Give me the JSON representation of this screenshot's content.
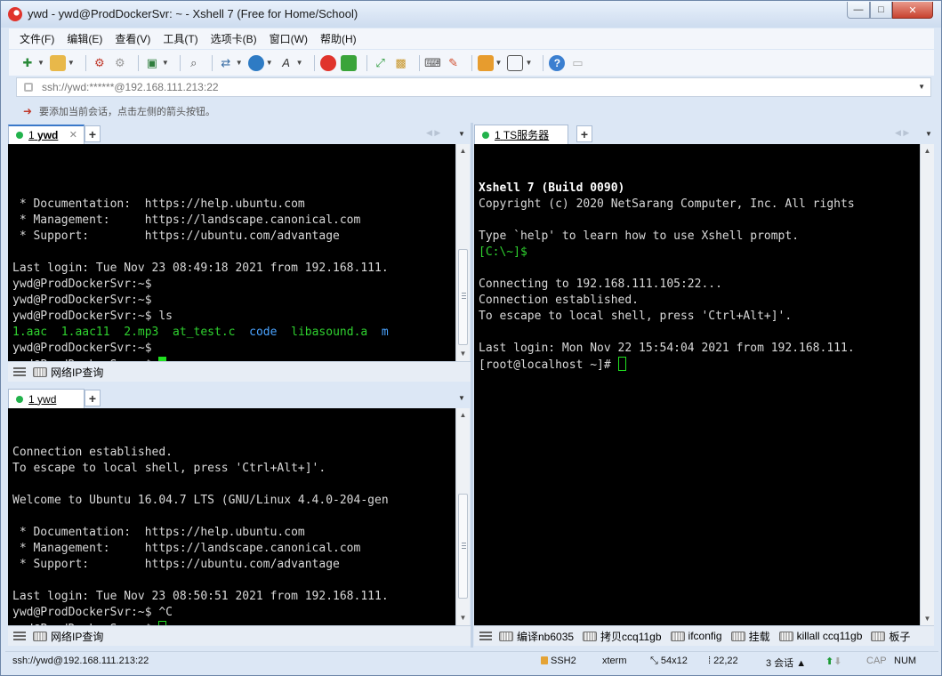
{
  "window": {
    "title": "ywd - ywd@ProdDockerSvr: ~ - Xshell 7 (Free for Home/School)",
    "controls": {
      "minimize": "—",
      "maximize": "□",
      "close": "✕"
    }
  },
  "menu": [
    "文件(F)",
    "编辑(E)",
    "查看(V)",
    "工具(T)",
    "选项卡(B)",
    "窗口(W)",
    "帮助(H)"
  ],
  "address": {
    "value": "ssh://ywd:******@192.168.111.213:22"
  },
  "hint": {
    "text": "要添加当前会话，点击左侧的箭头按钮。"
  },
  "panes": {
    "top_left": {
      "tab": {
        "index": "1",
        "label": "ywd"
      },
      "lines": [
        "",
        " * Documentation:  https://help.ubuntu.com",
        " * Management:     https://landscape.canonical.com",
        " * Support:        https://ubuntu.com/advantage",
        "",
        "Last login: Tue Nov 23 08:49:18 2021 from 192.168.111.",
        "ywd@ProdDockerSvr:~$",
        "ywd@ProdDockerSvr:~$",
        "ywd@ProdDockerSvr:~$ ls"
      ],
      "ls_output": [
        {
          "text": "1.aac",
          "color": "#2fd12f"
        },
        {
          "text": "1.aac11",
          "color": "#2fd12f"
        },
        {
          "text": "2.mp3",
          "color": "#2fd12f"
        },
        {
          "text": "at_test.c",
          "color": "#2fd12f"
        },
        {
          "text": "code",
          "color": "#4aa3ff"
        },
        {
          "text": "libasound.a",
          "color": "#2fd12f"
        },
        {
          "text": "m",
          "color": "#4aa3ff"
        }
      ],
      "after_ls": [
        "ywd@ProdDockerSvr:~$",
        "ywd@ProdDockerSvr:~$ "
      ],
      "quick_command": "网络IP查询"
    },
    "bottom_left": {
      "tab": {
        "index": "1",
        "label": "ywd"
      },
      "lines": [
        "Connection established.",
        "To escape to local shell, press 'Ctrl+Alt+]'.",
        "",
        "Welcome to Ubuntu 16.04.7 LTS (GNU/Linux 4.4.0-204-gen",
        "",
        " * Documentation:  https://help.ubuntu.com",
        " * Management:     https://landscape.canonical.com",
        " * Support:        https://ubuntu.com/advantage",
        "",
        "Last login: Tue Nov 23 08:50:51 2021 from 192.168.111.",
        "ywd@ProdDockerSvr:~$ ^C",
        "ywd@ProdDockerSvr:~$ "
      ],
      "quick_command": "网络IP查询"
    },
    "right": {
      "tab": {
        "index": "1",
        "label": "TS服务器"
      },
      "lines": [
        "Xshell 7 (Build 0090)",
        "Copyright (c) 2020 NetSarang Computer, Inc. All rights",
        "",
        "Type `help' to learn how to use Xshell prompt.",
        "[C:\\~]$",
        "",
        "Connecting to 192.168.111.105:22...",
        "Connection established.",
        "To escape to local shell, press 'Ctrl+Alt+]'.",
        "",
        "Last login: Mon Nov 22 15:54:04 2021 from 192.168.111.",
        "[root@localhost ~]# "
      ],
      "quick_commands": [
        "编译nb6035",
        "拷贝ccq11gb",
        "ifconfig",
        "挂载",
        "killall ccq11gb",
        "板子"
      ]
    }
  },
  "status": {
    "connection": "ssh://ywd@192.168.111.213:22",
    "protocol": "SSH2",
    "terminal": "xterm",
    "size": "54x12",
    "cursor": "22,22",
    "sessions": "3 会话",
    "cap": "CAP",
    "num": "NUM"
  }
}
